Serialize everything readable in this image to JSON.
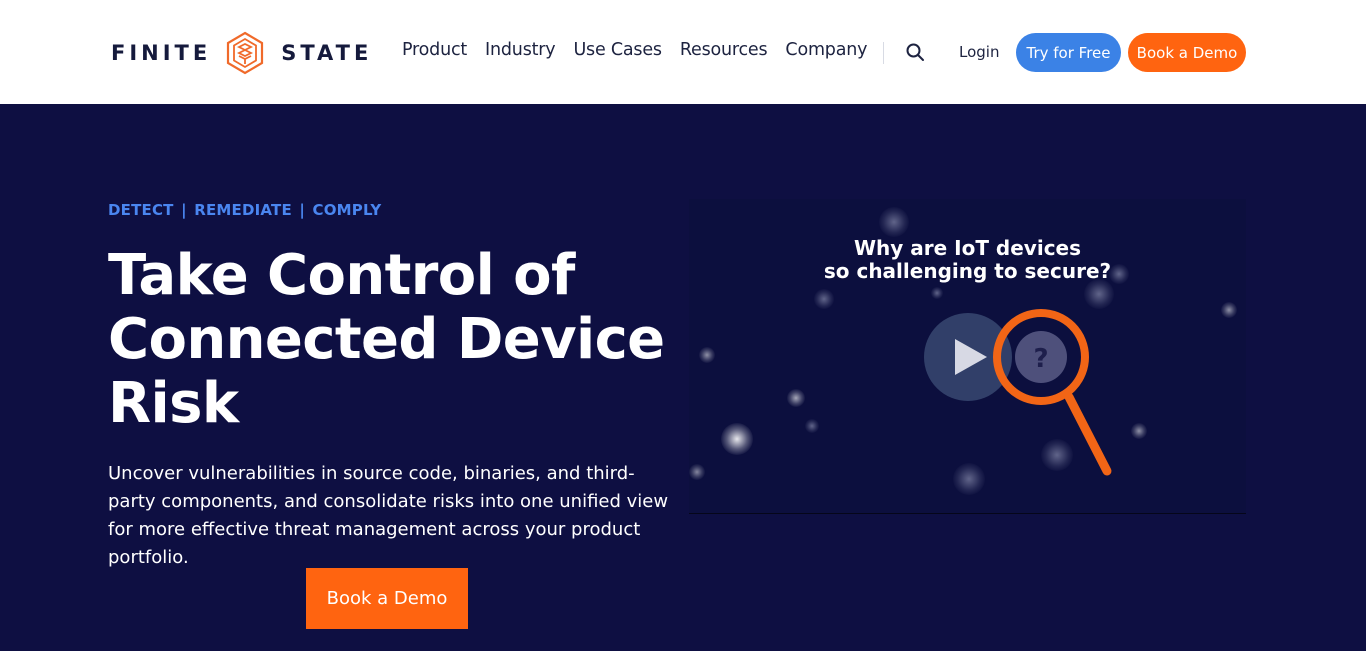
{
  "brand": {
    "name_left": "FINITE",
    "name_right": "STATE",
    "accent": "#ff6410",
    "primary_blue": "#3b82e6",
    "navy": "#0e0f42"
  },
  "nav": {
    "items": [
      {
        "label": "Product"
      },
      {
        "label": "Industry"
      },
      {
        "label": "Use Cases"
      },
      {
        "label": "Resources"
      },
      {
        "label": "Company"
      }
    ],
    "search_icon": "search-icon",
    "login_label": "Login",
    "try_label": "Try for Free",
    "demo_label": "Book a Demo"
  },
  "hero": {
    "eyebrow": [
      "DETECT",
      "REMEDIATE",
      "COMPLY"
    ],
    "eyebrow_separator": "|",
    "headline": "Take Control of Connected Device Risk",
    "body": "Uncover vulnerabilities in source code, binaries, and third-party components, and consolidate risks into one unified view for more effective threat management across your product portfolio.",
    "cta_label": "Book a Demo"
  },
  "video": {
    "title_line1": "Why are IoT devices",
    "title_line2": "so challenging to secure?",
    "play_icon": "play-icon",
    "magnifier_icon": "magnifier-question-icon",
    "question_mark": "?"
  }
}
